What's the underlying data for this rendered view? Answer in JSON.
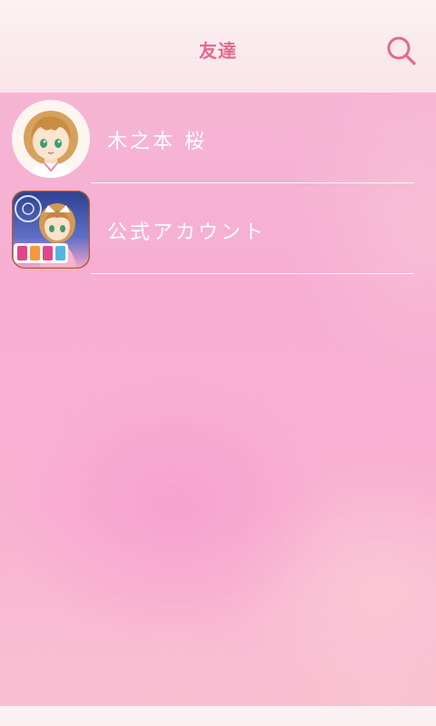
{
  "header": {
    "title": "友達"
  },
  "icons": {
    "search": "search-icon"
  },
  "friends": [
    {
      "name": "木之本 桜",
      "avatar": "sakura-avatar"
    },
    {
      "name": "公式アカウント",
      "avatar": "official-account-icon"
    }
  ],
  "colors": {
    "title": "#e36a8e",
    "header_bg": "#fbf2f3",
    "background": "#f6b0d2",
    "label": "#ffffff"
  }
}
